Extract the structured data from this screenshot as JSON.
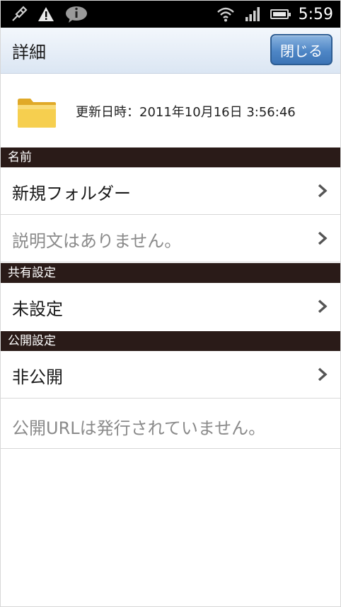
{
  "status_bar": {
    "time": "5:59",
    "icons": [
      "usb-debug-icon",
      "warning-icon",
      "info-icon",
      "wifi-icon",
      "signal-icon",
      "battery-icon"
    ]
  },
  "header": {
    "title": "詳細",
    "close_label": "閉じる"
  },
  "info": {
    "updated_label": "更新日時：2011年10月16日 3:56:46",
    "icon": "folder-icon"
  },
  "sections": {
    "name": {
      "header": "名前",
      "name_value": "新規フォルダー",
      "description": "説明文はありません。"
    },
    "share": {
      "header": "共有設定",
      "value": "未設定"
    },
    "publish": {
      "header": "公開設定",
      "value": "非公開",
      "url_note": "公開URLは発行されていません。"
    }
  },
  "colors": {
    "section_header_bg": "#2a1b18",
    "button_blue": "#4f87c6",
    "muted_text": "#8a8a8a"
  }
}
